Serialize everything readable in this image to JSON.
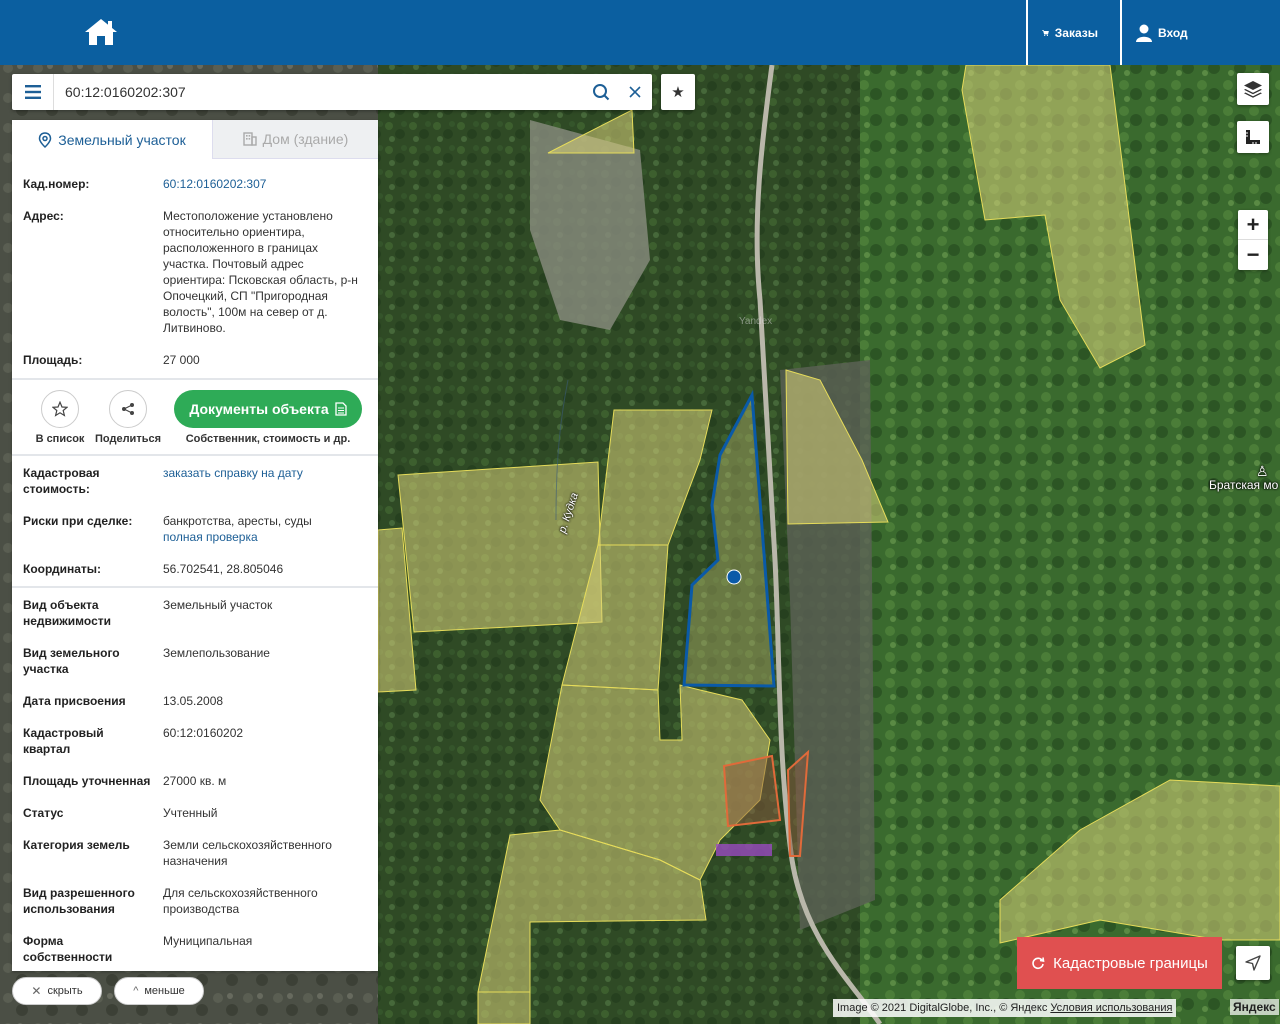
{
  "topbar": {
    "home_icon": "home-icon",
    "orders_label": "Заказы",
    "login_label": "Вход"
  },
  "search": {
    "value": "60:12:0160202:307"
  },
  "tabs": [
    {
      "label": "Земельный участок",
      "active": true
    },
    {
      "label": "Дом (здание)",
      "active": false
    }
  ],
  "info": {
    "kad_number": {
      "label": "Кад.номер:",
      "value": "60:12:0160202:307"
    },
    "address": {
      "label": "Адрес:",
      "value": "Местоположение установлено относительно ориентира, расположенного в границах участка. Почтовый адрес ориентира: Псковская область, р-н Опочецкий, СП \"Пригородная волость\", 100м на север от д. Литвиново."
    },
    "area": {
      "label": "Площадь:",
      "value": "27 000"
    }
  },
  "actions": {
    "add_to_list": "В список",
    "share": "Поделиться",
    "documents_button": "Документы объекта",
    "documents_sub": "Собственник, стоимость и др."
  },
  "details": {
    "cadastral_value": {
      "label": "Кадастровая стоимость:",
      "value": "заказать справку на дату"
    },
    "risks": {
      "label": "Риски при сделке:",
      "value": "банкротства, аресты, суды",
      "link": "полная проверка"
    },
    "coords": {
      "label": "Координаты:",
      "value": "56.702541, 28.805046"
    }
  },
  "attributes": [
    {
      "label": "Вид объекта недвижимости",
      "value": "Земельный участок"
    },
    {
      "label": "Вид земельного участка",
      "value": "Землепользование"
    },
    {
      "label": "Дата присвоения",
      "value": "13.05.2008"
    },
    {
      "label": "Кадастровый квартал",
      "value": "60:12:0160202"
    },
    {
      "label": "Площадь уточненная",
      "value": "27000 кв. м"
    },
    {
      "label": "Статус",
      "value": "Учтенный"
    },
    {
      "label": "Категория земель",
      "value": "Земли сельскохозяйственного назначения"
    },
    {
      "label": "Вид разрешенного использования",
      "value": "Для сельскохозяйственного производства"
    },
    {
      "label": "Форма собственности",
      "value": "Муниципальная"
    }
  ],
  "panel_controls": {
    "hide": "скрыть",
    "less": "меньше"
  },
  "map": {
    "river_label": "р. Кудка",
    "place_label": "Братская мо",
    "watermark": "Yandex",
    "cadastral_button": "Кадастровые границы",
    "copyright": "Image © 2021 DigitalGlobe, Inc., © Яндекс",
    "terms": "Условия использования",
    "logo": "Яндекс",
    "colors": {
      "parcel_fill": "#d8d27a",
      "selected_parcel": "#0a5aa8",
      "building": "#e06a3a",
      "accent": "#0b5fa0",
      "green_button": "#2eab57",
      "red_button": "#e05050"
    }
  }
}
